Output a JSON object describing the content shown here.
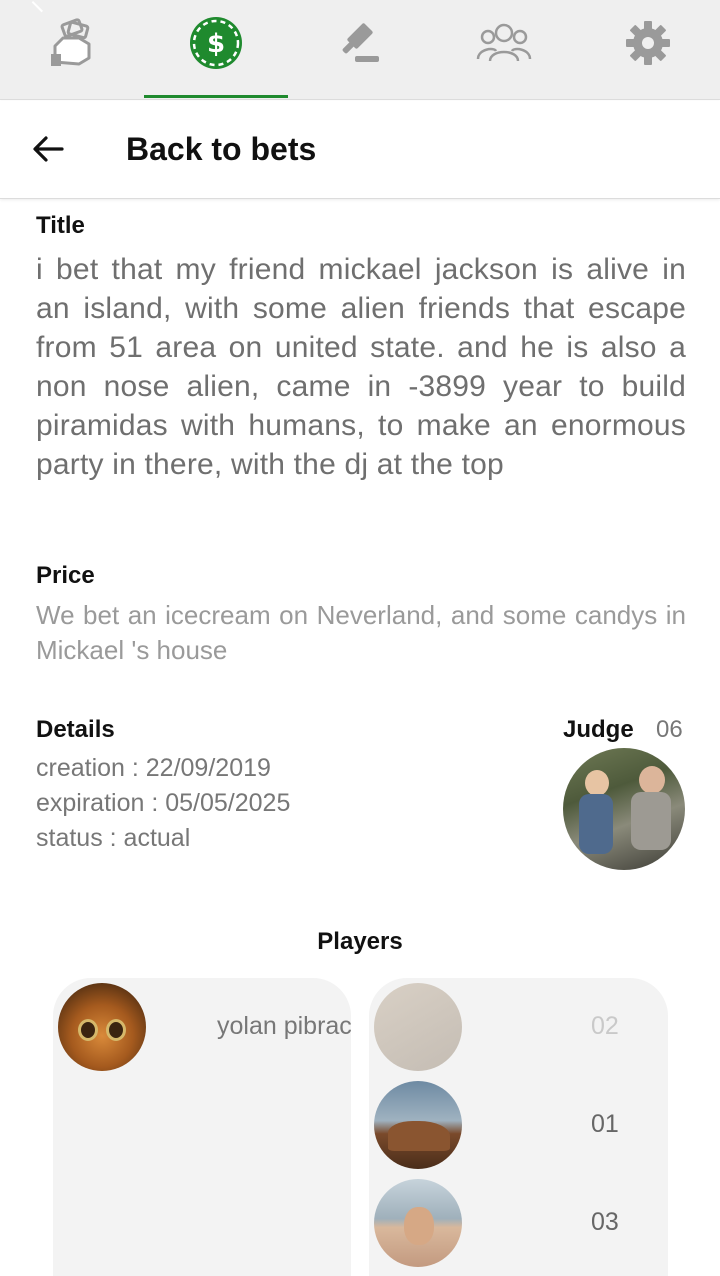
{
  "tabs": [
    {
      "name": "bets-hand",
      "icon": "money-hand-icon"
    },
    {
      "name": "bets",
      "icon": "dollar-chip-icon",
      "active": true
    },
    {
      "name": "judge",
      "icon": "gavel-icon"
    },
    {
      "name": "friends",
      "icon": "group-icon"
    },
    {
      "name": "settings",
      "icon": "gear-icon"
    }
  ],
  "colors": {
    "accent": "#1f8a2e",
    "tab_icon": "#9a9a9a",
    "card_bg": "#f3f3f3"
  },
  "header": {
    "back_label": "Back to bets"
  },
  "title": {
    "label": "Title",
    "text": "i bet that my friend mickael jackson is alive in an island, with some alien friends that escape from 51 area on united state. and he is also a non nose alien, came in -3899 year to build piramidas with humans, to make an enormous party in there, with the dj at the top"
  },
  "price": {
    "label": "Price",
    "text": "We bet an icecream on Neverland, and some candys in Mickael 's house"
  },
  "details": {
    "label": "Details",
    "creation": "creation : 22/09/2019",
    "expiration": "expiration : 05/05/2025",
    "status": "status : actual"
  },
  "judge": {
    "label": "Judge",
    "count": "06"
  },
  "players": {
    "label": "Players",
    "left": {
      "name": "yolan pibrac"
    },
    "right": [
      {
        "votes": "02",
        "faded": true
      },
      {
        "votes": "01"
      },
      {
        "votes": "03"
      }
    ]
  }
}
